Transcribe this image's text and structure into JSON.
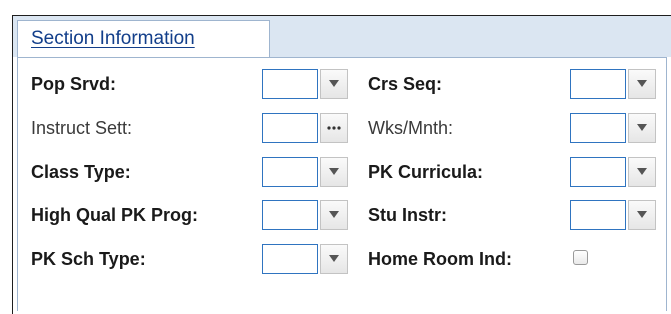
{
  "section_tab": {
    "label": "Section Information"
  },
  "rows": [
    {
      "left": {
        "label": "Pop Srvd:",
        "value": "",
        "button_icon": "dropdown-arrow-icon"
      },
      "right": {
        "label": "Crs Seq:",
        "value": "",
        "button_icon": "dropdown-arrow-icon"
      }
    },
    {
      "left": {
        "label": "Instruct Sett:",
        "value": "",
        "button_icon": "ellipsis-icon"
      },
      "right": {
        "label": "Wks/Mnth:",
        "value": "",
        "button_icon": "dropdown-arrow-icon"
      }
    },
    {
      "left": {
        "label": "Class Type:",
        "value": "",
        "button_icon": "dropdown-arrow-icon"
      },
      "right": {
        "label": "PK Curricula:",
        "value": "",
        "button_icon": "dropdown-arrow-icon"
      }
    },
    {
      "left": {
        "label": "High Qual PK Prog:",
        "value": "",
        "button_icon": "dropdown-arrow-icon"
      },
      "right": {
        "label": "Stu Instr:",
        "value": "",
        "button_icon": "dropdown-arrow-icon"
      }
    },
    {
      "left": {
        "label": "PK Sch Type:",
        "value": "",
        "button_icon": "dropdown-arrow-icon"
      },
      "right": {
        "label": "Home Room Ind:",
        "checked": false
      }
    }
  ],
  "colors": {
    "tab_text": "#123e8a",
    "field_border": "#2f74c0",
    "panel_border": "#9fb5cf",
    "header_strip": "#dbe6f2"
  }
}
